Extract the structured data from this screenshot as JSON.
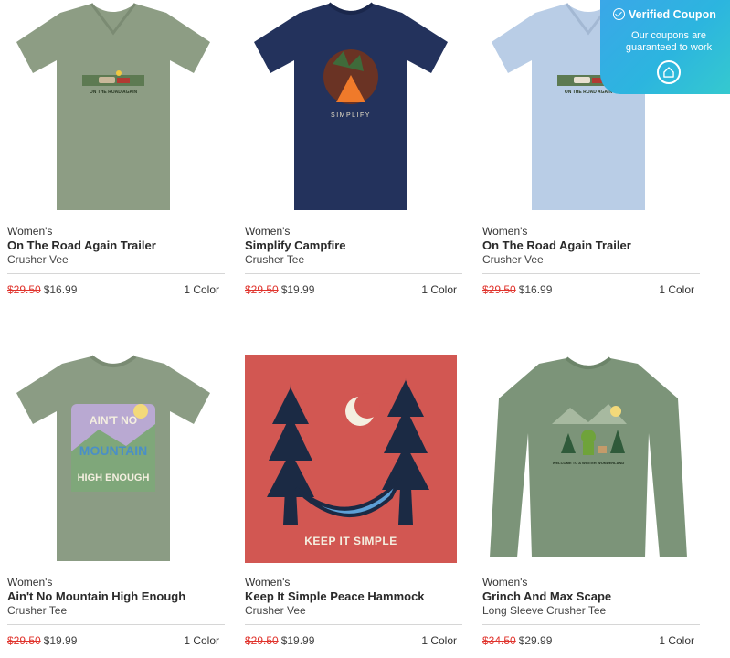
{
  "coupon": {
    "title": "Verified Coupon",
    "subtitle": "Our coupons are guaranteed to work"
  },
  "products": [
    {
      "gender": "Women's",
      "title": "On The Road Again Trailer",
      "style": "Crusher Vee",
      "was": "$29.50",
      "now": "$16.99",
      "colors": "1 Color",
      "shirt_color": "#8d9d84",
      "image_text": "ON THE ROAD AGAIN"
    },
    {
      "gender": "Women's",
      "title": "Simplify Campfire",
      "style": "Crusher Tee",
      "was": "$29.50",
      "now": "$19.99",
      "colors": "1 Color",
      "shirt_color": "#23325c",
      "image_text": "SIMPLIFY"
    },
    {
      "gender": "Women's",
      "title": "On The Road Again Trailer",
      "style": "Crusher Vee",
      "was": "$29.50",
      "now": "$16.99",
      "colors": "1 Color",
      "shirt_color": "#b9cde6",
      "image_text": "ON THE ROAD AGAIN"
    },
    {
      "gender": "Women's",
      "title": "Ain't No Mountain High Enough",
      "style": "Crusher Tee",
      "was": "$29.50",
      "now": "$19.99",
      "colors": "1 Color",
      "shirt_color": "#8b9c84",
      "image_text": "AIN'T NO MOUNTAIN HIGH ENOUGH"
    },
    {
      "gender": "Women's",
      "title": "Keep It Simple Peace Hammock",
      "style": "Crusher Vee",
      "was": "$29.50",
      "now": "$19.99",
      "colors": "1 Color",
      "shirt_color": "#d25752",
      "image_text": "KEEP IT SIMPLE"
    },
    {
      "gender": "Women's",
      "title": "Grinch And Max Scape",
      "style": "Long Sleeve Crusher Tee",
      "was": "$34.50",
      "now": "$29.99",
      "colors": "1 Color",
      "shirt_color": "#7c9479",
      "image_text": "WELCOME TO A WINTER WONDERLAND"
    }
  ]
}
